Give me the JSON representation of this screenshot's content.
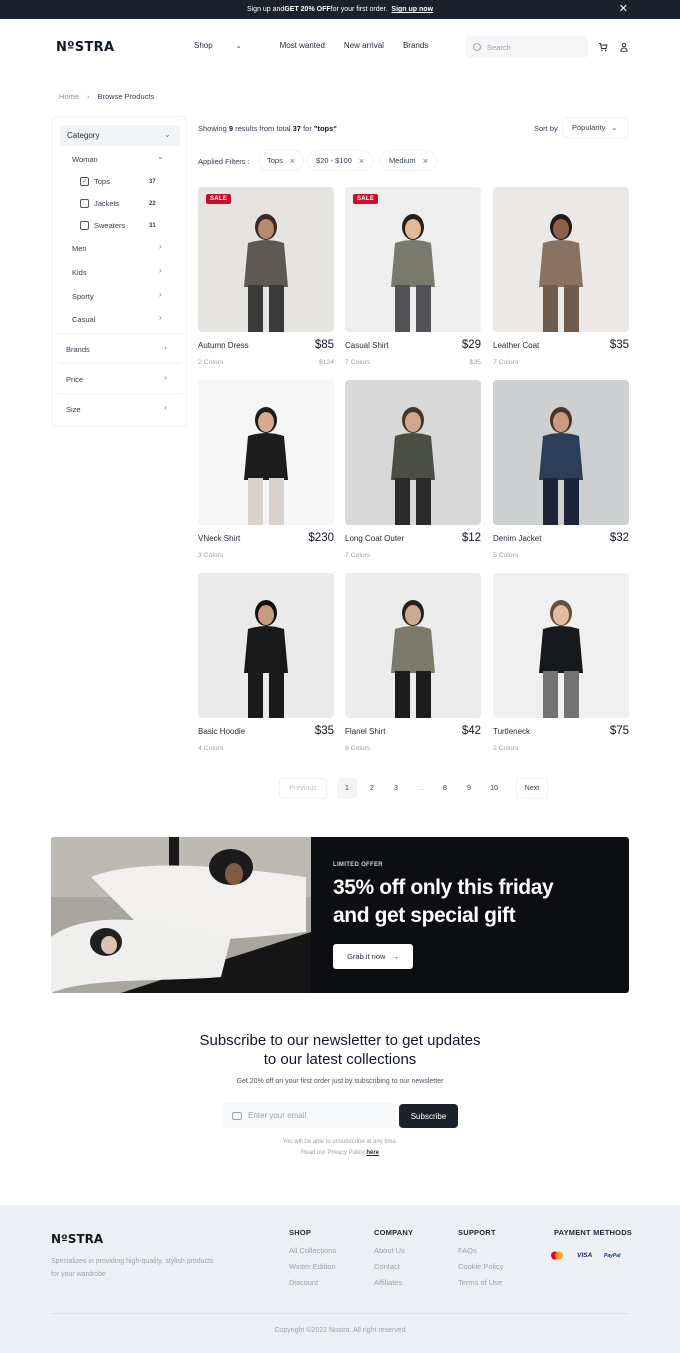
{
  "announcement": {
    "prefix": "Sign up and ",
    "bold": "GET 20% OFF",
    "suffix": " for your first order.",
    "cta": "Sign up now"
  },
  "header": {
    "logo": "NºSTRA",
    "nav": [
      {
        "label": "Shop"
      },
      {
        "label": "Most wanted"
      },
      {
        "label": "New arrival"
      },
      {
        "label": "Brands"
      }
    ],
    "search_placeholder": "Search"
  },
  "breadcrumb": {
    "home": "Home",
    "current": "Browse Products"
  },
  "sidebar": {
    "category": "Category",
    "woman": "Woman",
    "subitems": [
      {
        "label": "Tops",
        "count": "37",
        "checked": true
      },
      {
        "label": "Jackets",
        "count": "22",
        "checked": false
      },
      {
        "label": "Sweaters",
        "count": "31",
        "checked": false
      }
    ],
    "groups": [
      "Men",
      "Kids",
      "Sporty",
      "Casual"
    ],
    "sections": [
      "Brands",
      "Price",
      "Size"
    ]
  },
  "results": {
    "prefix": "Showing ",
    "shown": "9",
    "middle": " results from total ",
    "total": "37",
    "for": " for ",
    "query": "\"tops\""
  },
  "sort": {
    "label": "Sort by",
    "value": "Popularity"
  },
  "filters": {
    "label": "Applied Filters :",
    "chips": [
      "Tops",
      "$20 - $100",
      "Medium"
    ]
  },
  "products": [
    {
      "name": "Autumn Dress",
      "price": "$85",
      "colors": "2 Colors",
      "old_price": "$124",
      "sale": "SALE"
    },
    {
      "name": "Casual Shirt",
      "price": "$29",
      "colors": "7 Colors",
      "old_price": "$35",
      "sale": "SALE"
    },
    {
      "name": "Leather Coat",
      "price": "$35",
      "colors": "7 Colors"
    },
    {
      "name": "VNeck Shirt",
      "price": "$230",
      "colors": "3 Colors"
    },
    {
      "name": "Long Coat Outer",
      "price": "$12",
      "colors": "7 Colors"
    },
    {
      "name": "Denim Jacket",
      "price": "$32",
      "colors": "5 Colors"
    },
    {
      "name": "Basic Hoodie",
      "price": "$35",
      "colors": "4 Colors"
    },
    {
      "name": "Flanel Shirt",
      "price": "$42",
      "colors": "8 Colors"
    },
    {
      "name": "Turtleneck",
      "price": "$75",
      "colors": "2 Colors"
    }
  ],
  "pagination": {
    "previous": "Previous",
    "pages": [
      "1",
      "2",
      "3",
      "...",
      "8",
      "9",
      "10"
    ],
    "current": "1",
    "next": "Next"
  },
  "promo": {
    "tag": "LIMITED OFFER",
    "headline_line1": "35% off only this friday",
    "headline_line2": "and get special gift",
    "button": "Grab it now",
    "button_icon": "→"
  },
  "newsletter": {
    "title_line1": "Subscribe to our newsletter to get updates",
    "title_line2": "to our latest collections",
    "subtitle": "Get 20% off on your first order just by subscribing to our newsletter",
    "placeholder": "Enter your email",
    "button": "Subscribe",
    "note_line1": "You will be able to unsubscribe at any time.",
    "note_line2": "Read our Privacy Policy ",
    "note_link": "here"
  },
  "footer": {
    "logo": "NºSTRA",
    "description": "Specializes in providing high-quality, stylish products for your wardrobe",
    "columns": [
      {
        "title": "SHOP",
        "links": [
          "All Collections",
          "Winter Edition",
          "Discount"
        ]
      },
      {
        "title": "COMPANY",
        "links": [
          "About Us",
          "Contact",
          "Affiliates"
        ]
      },
      {
        "title": "SUPPORT",
        "links": [
          "FAQs",
          "Cookie Policy",
          "Terms of Use"
        ]
      }
    ],
    "payment_title": "PAYMENT METHODS",
    "payments": [
      "Mastercard",
      "VISA",
      "PayPal"
    ],
    "copyright": "Copyright ©2022 Nostra. All right reserved"
  },
  "colors": {
    "dark": "#1c222d",
    "sale": "#c8102e",
    "promo_bg": "#0d0e11",
    "footer_bg": "#eceff4"
  }
}
